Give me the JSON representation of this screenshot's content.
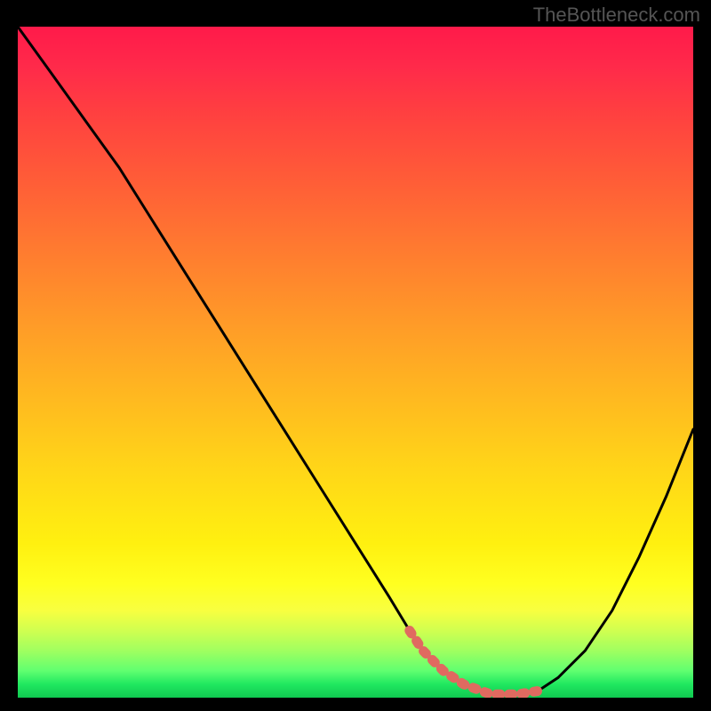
{
  "watermark": "TheBottleneck.com",
  "chart_data": {
    "type": "line",
    "title": "",
    "xlabel": "",
    "ylabel": "",
    "xlim": [
      0,
      100
    ],
    "ylim": [
      0,
      100
    ],
    "curve": {
      "x": [
        0,
        5,
        10,
        15,
        20,
        25,
        30,
        35,
        40,
        45,
        50,
        55,
        58,
        60,
        63,
        66,
        70,
        74,
        77,
        80,
        84,
        88,
        92,
        96,
        100
      ],
      "values": [
        100,
        93,
        86,
        79,
        71,
        63,
        55,
        47,
        39,
        31,
        23,
        15,
        10,
        7,
        4,
        2,
        0.5,
        0.5,
        1,
        3,
        7,
        13,
        21,
        30,
        40
      ]
    },
    "highlight_segment": {
      "x": [
        58,
        60,
        63,
        66,
        70,
        74,
        77
      ],
      "values": [
        10,
        7,
        4,
        2,
        0.5,
        0.5,
        1
      ]
    },
    "gradient_stops": [
      {
        "pos": 0.0,
        "color": "#ff1a4a"
      },
      {
        "pos": 0.5,
        "color": "#ffb820"
      },
      {
        "pos": 0.85,
        "color": "#ffff20"
      },
      {
        "pos": 1.0,
        "color": "#10c850"
      }
    ]
  }
}
